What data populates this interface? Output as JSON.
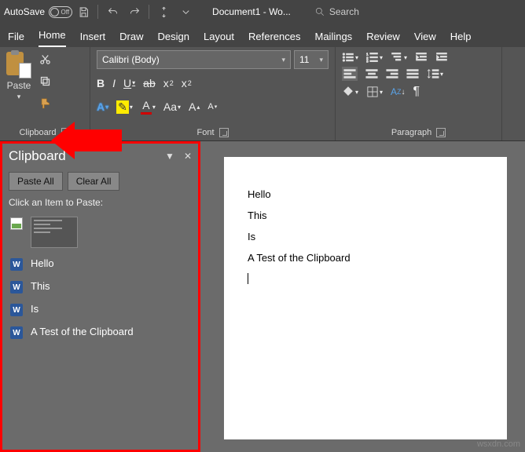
{
  "titlebar": {
    "autosave_label": "AutoSave",
    "autosave_state": "Off",
    "doc_title": "Document1 - Wo...",
    "search_label": "Search"
  },
  "tabs": {
    "file": "File",
    "home": "Home",
    "insert": "Insert",
    "draw": "Draw",
    "design": "Design",
    "layout": "Layout",
    "references": "References",
    "mailings": "Mailings",
    "review": "Review",
    "view": "View",
    "help": "Help"
  },
  "ribbon": {
    "clipboard": {
      "label": "Clipboard",
      "paste": "Paste"
    },
    "font": {
      "label": "Font",
      "name": "Calibri (Body)",
      "size": "11"
    },
    "paragraph": {
      "label": "Paragraph"
    }
  },
  "clipboard_pane": {
    "title": "Clipboard",
    "paste_all": "Paste All",
    "clear_all": "Clear All",
    "hint": "Click an Item to Paste:",
    "items": [
      {
        "type": "picture",
        "label": ""
      },
      {
        "type": "word",
        "label": "Hello"
      },
      {
        "type": "word",
        "label": "This"
      },
      {
        "type": "word",
        "label": "Is"
      },
      {
        "type": "word",
        "label": "A Test of the Clipboard"
      }
    ]
  },
  "document": {
    "lines": [
      "Hello",
      "This",
      "Is",
      "A Test of the Clipboard"
    ]
  },
  "watermark": "wsxdn.com"
}
